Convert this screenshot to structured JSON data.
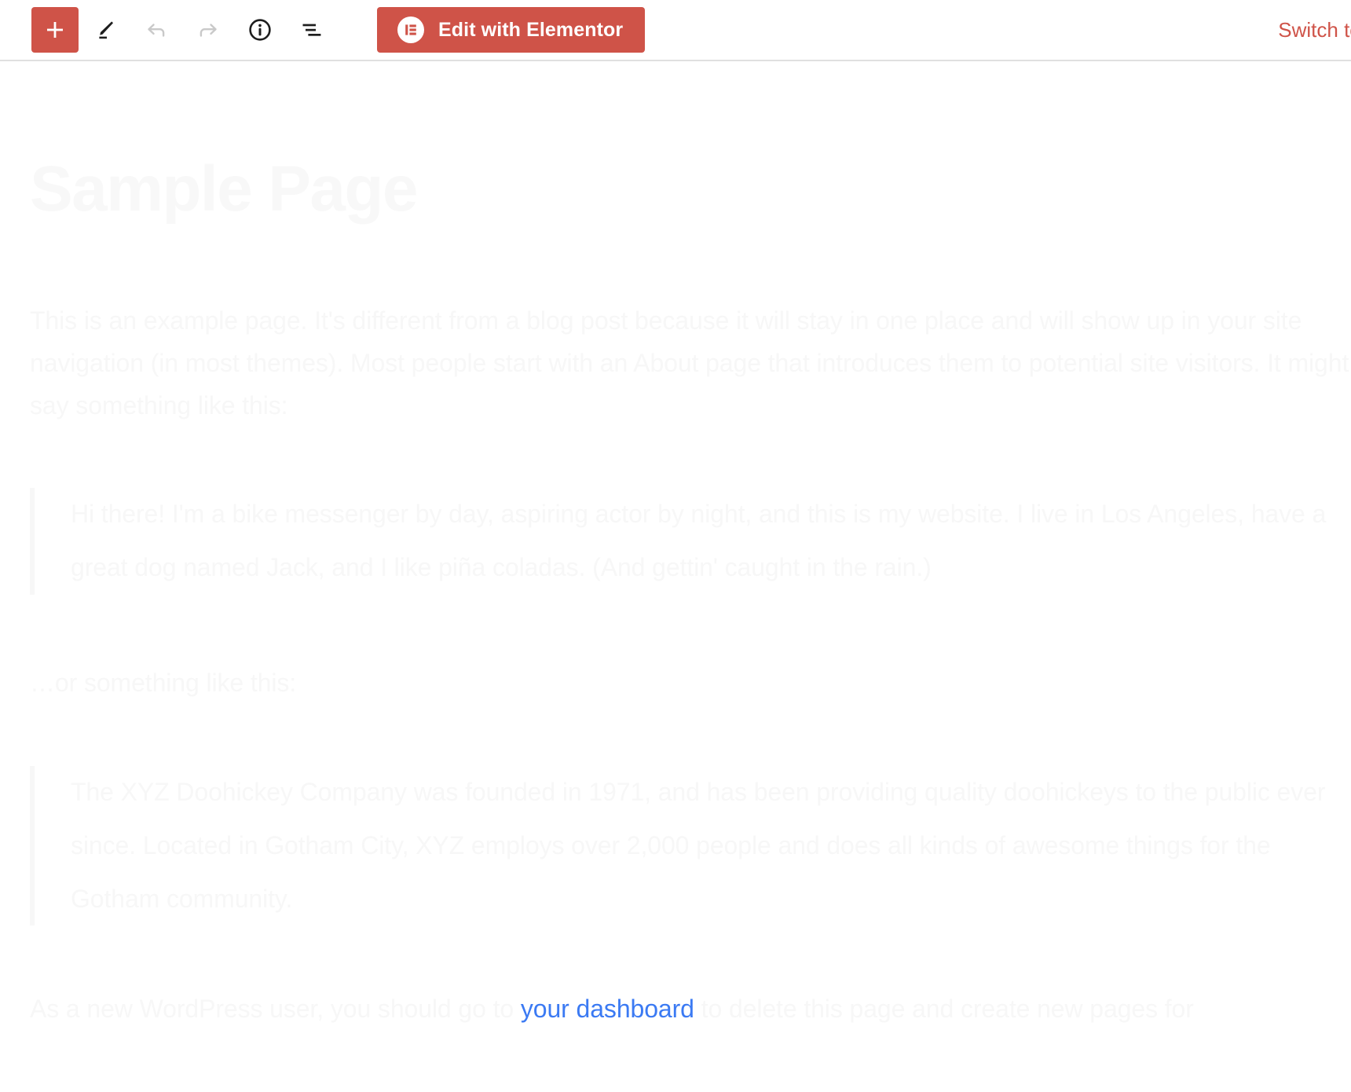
{
  "toolbar": {
    "add_block": {
      "label": "+",
      "icon": "plus-icon",
      "title": "Add block"
    },
    "edit_tool": {
      "icon": "pencil-icon",
      "title": "Edit"
    },
    "undo": {
      "icon": "undo-arrow-icon",
      "title": "Undo"
    },
    "redo": {
      "icon": "redo-arrow-icon",
      "title": "Redo"
    },
    "details": {
      "icon": "info-circle-icon",
      "title": "Details"
    },
    "list_view": {
      "icon": "list-view-icon",
      "title": "List view"
    },
    "elementor": {
      "label": "Edit with Elementor",
      "icon": "elementor-logo-icon",
      "bg_color": "#cf5348",
      "text_color": "#ffffff"
    },
    "switch_to_draft": {
      "label": "Switch to draft",
      "color": "#cf5348"
    }
  },
  "page": {
    "title": "Sample Page",
    "title_color": "#f8f8f8",
    "body_color": "#f7f7f7",
    "link_color": "#3b7af3",
    "paragraph_1": "This is an example page. It's different from a blog post because it will stay in one place and will show up in your site navigation (in most themes). Most people start with an About page that introduces them to potential site visitors. It might say something like this:",
    "quote_1": "Hi there! I'm a bike messenger by day, aspiring actor by night, and this is my website. I live in Los Angeles, have a great dog named Jack, and I like piña coladas. (And gettin' caught in the rain.)",
    "paragraph_2": "…or something like this:",
    "quote_2": "The XYZ Doohickey Company was founded in 1971, and has been providing quality doohickeys to the public ever since. Located in Gotham City, XYZ employs over 2,000 people and does all kinds of awesome things for the Gotham community.",
    "paragraph_3_before": "As a new WordPress user, you should go to ",
    "paragraph_3_link": "your dashboard",
    "paragraph_3_after": " to delete this page and create new pages for"
  }
}
